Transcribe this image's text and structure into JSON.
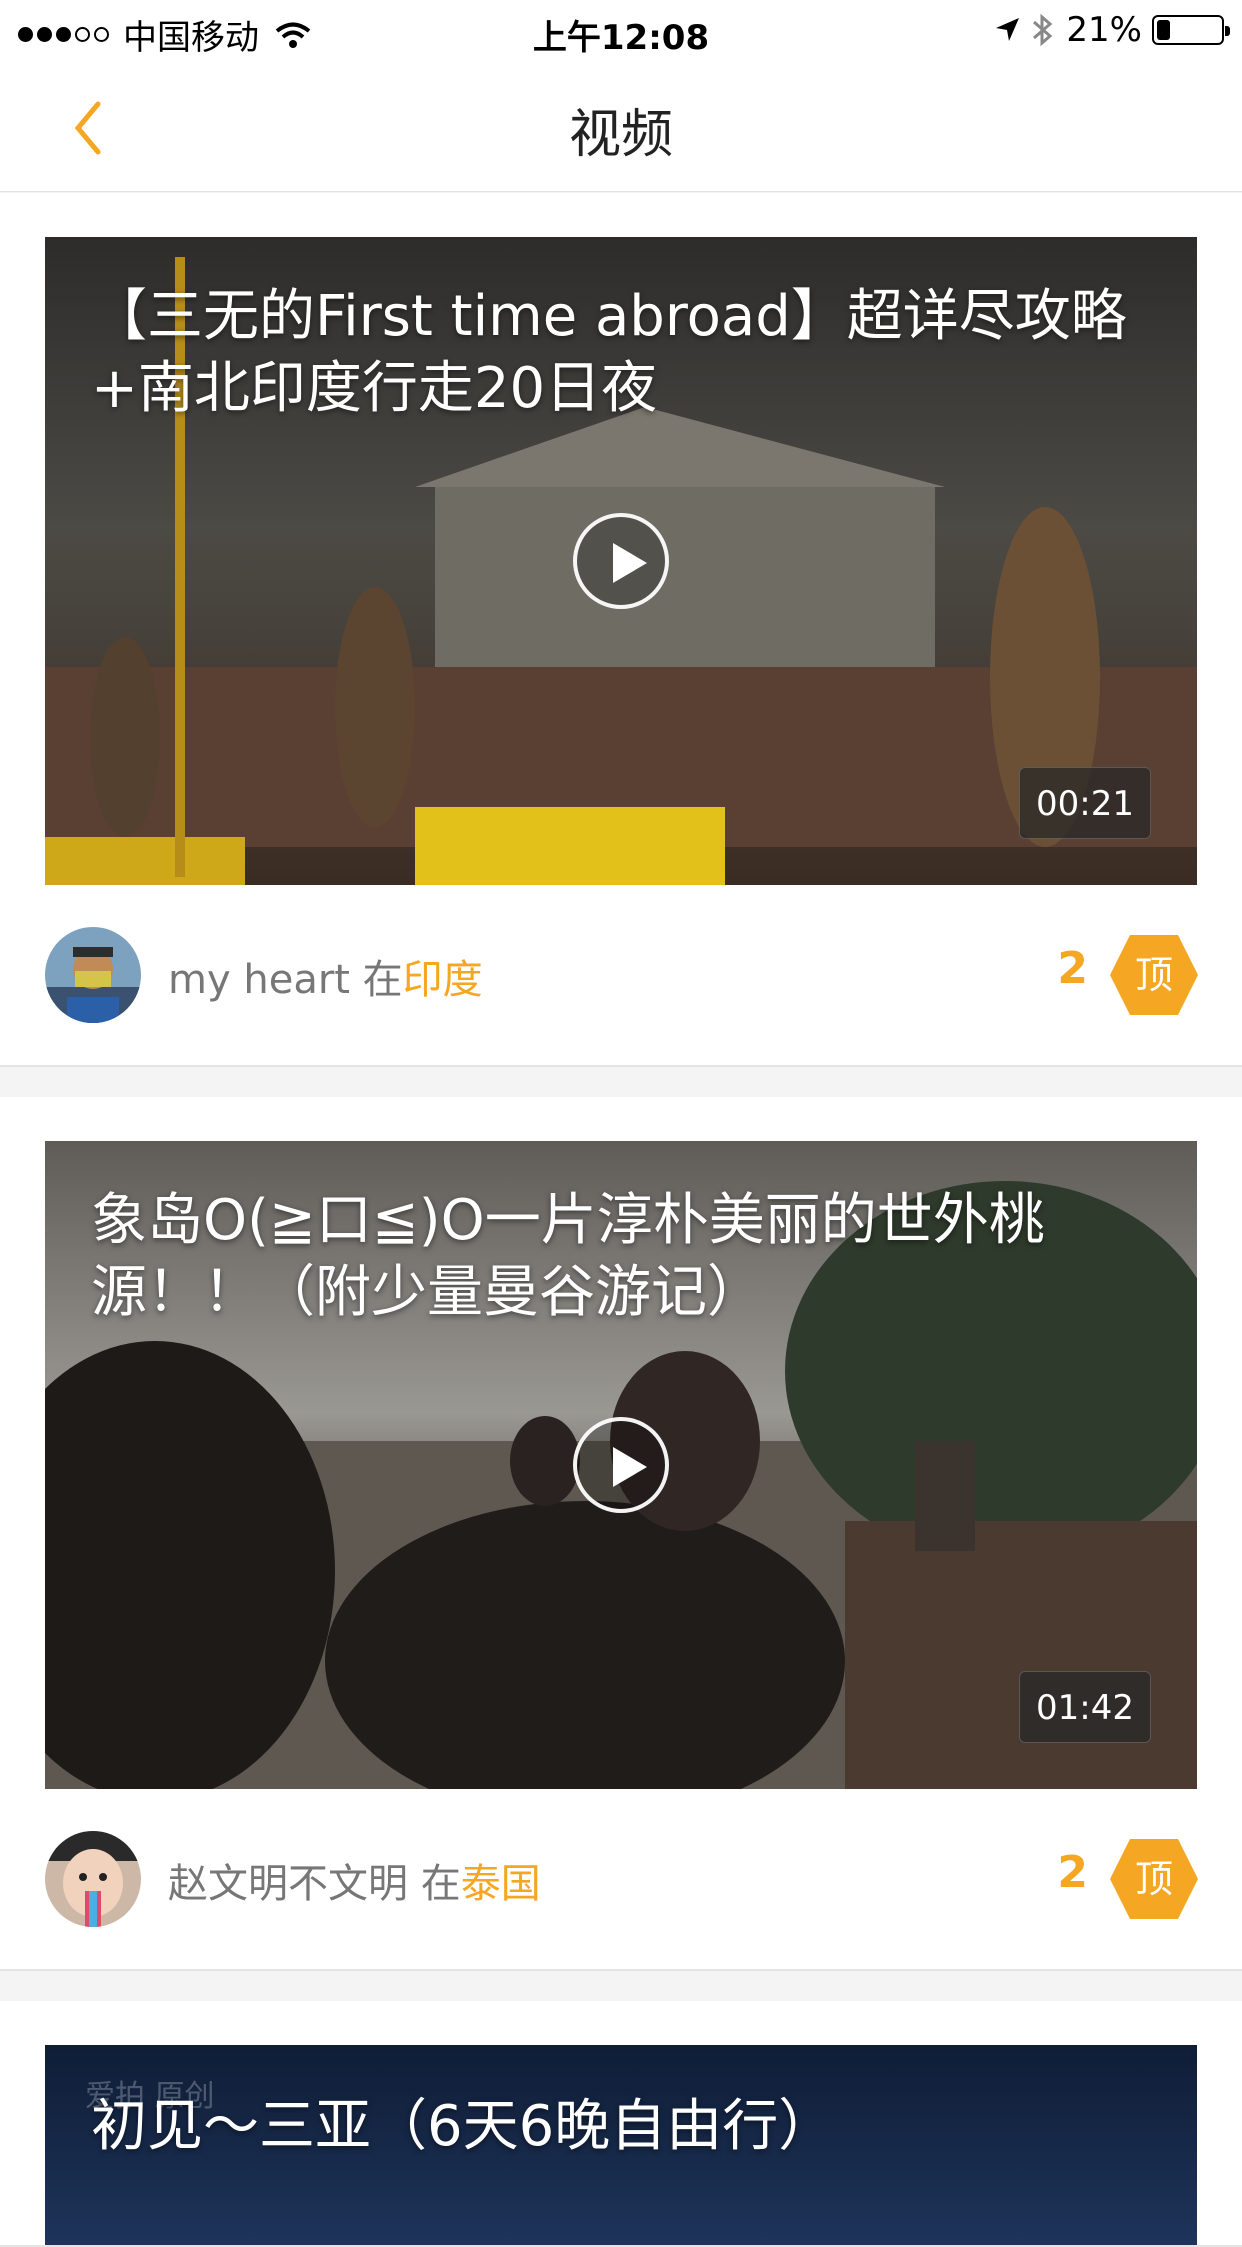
{
  "status_bar": {
    "carrier": "中国移动",
    "time": "上午12:08",
    "battery": "21%",
    "battery_level": 0.21
  },
  "nav": {
    "title": "视频"
  },
  "videos": [
    {
      "title": "【三无的First time abroad】超详尽攻略+南北印度行走20日夜",
      "duration": "00:21",
      "author": "my heart",
      "preposition": " 在",
      "place": "印度",
      "likes": "2",
      "top_label": "顶"
    },
    {
      "title": "象岛O(≧口≦)O一片淳朴美丽的世外桃源！！（附少量曼谷游记）",
      "duration": "01:42",
      "author": "赵文明不文明",
      "preposition": " 在",
      "place": "泰国",
      "likes": "2",
      "top_label": "顶"
    },
    {
      "title": "初见～三亚（6天6晚自由行）",
      "watermark": "爱拍 原创"
    }
  ],
  "colors": {
    "accent": "#f5a623",
    "text_secondary": "#777777"
  }
}
